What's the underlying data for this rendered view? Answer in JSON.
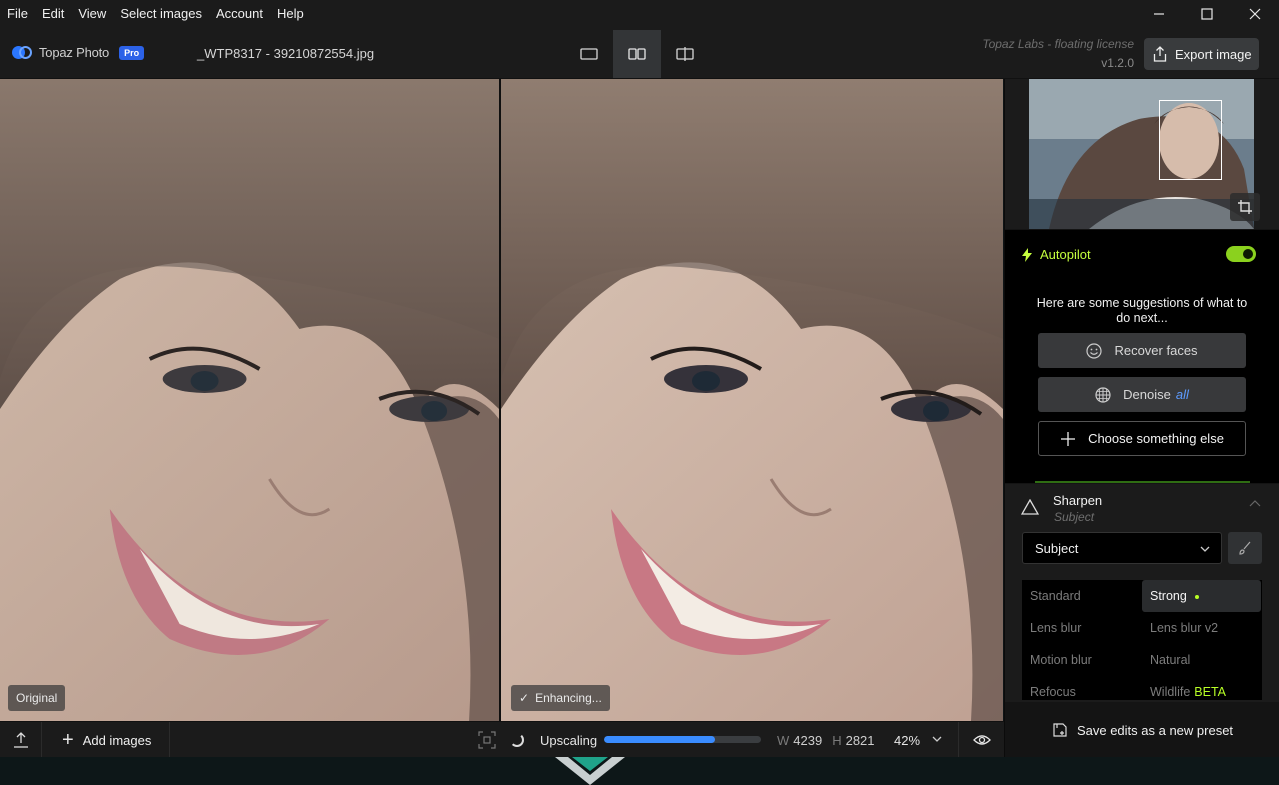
{
  "menu": [
    "File",
    "Edit",
    "View",
    "Select images",
    "Account",
    "Help"
  ],
  "window_controls": [
    "minimize-icon",
    "maximize-icon",
    "close-icon"
  ],
  "header": {
    "app_name": "Topaz Photo",
    "badge": "Pro",
    "filename": "_WTP8317 - 39210872554.jpg",
    "view_modes": [
      "single-view-icon",
      "side-by-side-icon",
      "split-view-icon"
    ],
    "active_view": "side-by-side",
    "license": "Topaz Labs - floating license",
    "version": "v1.2.0",
    "export_label": "Export image"
  },
  "panes": {
    "left_tag": "Original",
    "right_tag": "Enhancing..."
  },
  "bottom": {
    "add_images": "Add images",
    "status": "Upscaling",
    "progress": 0.71,
    "width_label": "W",
    "width": "4239",
    "height_label": "H",
    "height": "2821",
    "zoom": "42%"
  },
  "sidebar": {
    "autopilot": {
      "label": "Autopilot",
      "enabled": true,
      "suggestion_text": "Here are some suggestions of what to do next...",
      "buttons": {
        "recover": "Recover faces",
        "denoise": "Denoise",
        "denoise_scope": "all",
        "choose": "Choose something else"
      }
    },
    "sharpen": {
      "title": "Sharpen",
      "subtitle": "Subject",
      "select_value": "Subject",
      "models": [
        {
          "label": "Standard",
          "selected": false
        },
        {
          "label": "Strong",
          "selected": true
        },
        {
          "label": "Lens blur",
          "selected": false
        },
        {
          "label": "Lens blur v2",
          "selected": false
        },
        {
          "label": "Motion blur",
          "selected": false
        },
        {
          "label": "Natural",
          "selected": false
        },
        {
          "label": "Refocus",
          "selected": false
        },
        {
          "label": "Wildlife",
          "selected": false,
          "badge": "BETA"
        }
      ]
    },
    "save_preset": "Save edits as a new preset"
  },
  "colors": {
    "accent_green": "#c6ff3e",
    "toggle_green": "#8bd11e",
    "progress_blue": "#3a8cff",
    "pro_badge": "#2c62e8",
    "denoise_all": "#5d9bff"
  }
}
